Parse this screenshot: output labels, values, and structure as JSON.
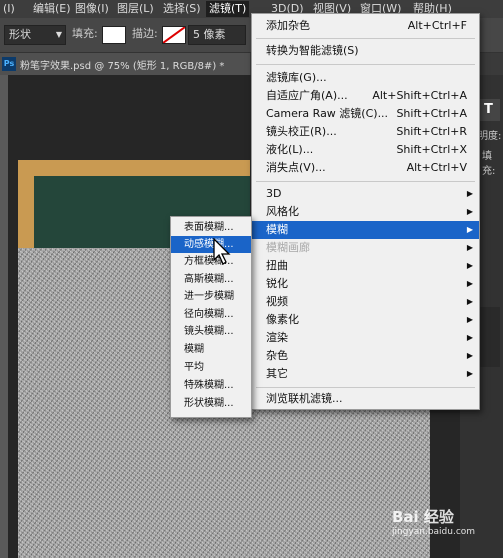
{
  "menubar": {
    "items": [
      "(I)",
      "编辑(E)",
      "图像(I)",
      "图层(L)",
      "选择(S)",
      "滤镜(T)",
      "3D(D)",
      "视图(V)",
      "窗口(W)",
      "帮助(H)"
    ]
  },
  "options": {
    "mode": "形状",
    "fill_label": "填充:",
    "stroke_label": "描边:",
    "stroke_size": "5 像素"
  },
  "document": {
    "tab_title": "粉笔字效果.psd @ 75% (矩形 1, RGB/8#) *",
    "ps_badge": "Ps"
  },
  "right_panel": {
    "letters": [
      "明度:",
      "填充:"
    ]
  },
  "filter_menu": {
    "items": [
      {
        "label": "添加杂色",
        "shortcut": "Alt+Ctrl+F"
      },
      {
        "label": "转换为智能滤镜(S)",
        "shortcut": ""
      },
      {
        "label": "滤镜库(G)...",
        "shortcut": ""
      },
      {
        "label": "自适应广角(A)...",
        "shortcut": "Alt+Shift+Ctrl+A"
      },
      {
        "label": "Camera Raw 滤镜(C)...",
        "shortcut": "Shift+Ctrl+A"
      },
      {
        "label": "镜头校正(R)...",
        "shortcut": "Shift+Ctrl+R"
      },
      {
        "label": "液化(L)...",
        "shortcut": "Shift+Ctrl+X"
      },
      {
        "label": "消失点(V)...",
        "shortcut": "Alt+Ctrl+V"
      },
      {
        "label": "3D"
      },
      {
        "label": "风格化"
      },
      {
        "label": "模糊"
      },
      {
        "label": "模糊画廊"
      },
      {
        "label": "扭曲"
      },
      {
        "label": "锐化"
      },
      {
        "label": "视频"
      },
      {
        "label": "像素化"
      },
      {
        "label": "渲染"
      },
      {
        "label": "杂色"
      },
      {
        "label": "其它"
      },
      {
        "label": "浏览联机滤镜..."
      }
    ]
  },
  "blur_submenu": {
    "items": [
      "表面模糊...",
      "动感模糊...",
      "方框模糊...",
      "高斯模糊...",
      "进一步模糊",
      "径向模糊...",
      "镜头模糊...",
      "模糊",
      "平均",
      "特殊模糊...",
      "形状模糊..."
    ]
  },
  "watermark": {
    "text": "Bai 经验",
    "url": "jingyan.baidu.com"
  },
  "colors": {
    "accent": "#1a64c8"
  }
}
